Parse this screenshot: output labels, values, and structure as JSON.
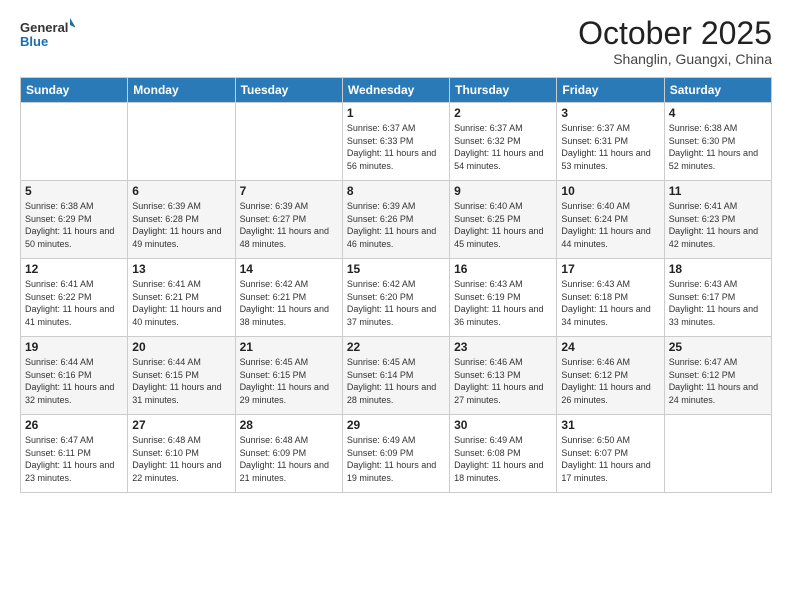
{
  "header": {
    "logo_general": "General",
    "logo_blue": "Blue",
    "month": "October 2025",
    "location": "Shanglin, Guangxi, China"
  },
  "days_of_week": [
    "Sunday",
    "Monday",
    "Tuesday",
    "Wednesday",
    "Thursday",
    "Friday",
    "Saturday"
  ],
  "weeks": [
    [
      {
        "day": "",
        "sunrise": "",
        "sunset": "",
        "daylight": ""
      },
      {
        "day": "",
        "sunrise": "",
        "sunset": "",
        "daylight": ""
      },
      {
        "day": "",
        "sunrise": "",
        "sunset": "",
        "daylight": ""
      },
      {
        "day": "1",
        "sunrise": "Sunrise: 6:37 AM",
        "sunset": "Sunset: 6:33 PM",
        "daylight": "Daylight: 11 hours and 56 minutes."
      },
      {
        "day": "2",
        "sunrise": "Sunrise: 6:37 AM",
        "sunset": "Sunset: 6:32 PM",
        "daylight": "Daylight: 11 hours and 54 minutes."
      },
      {
        "day": "3",
        "sunrise": "Sunrise: 6:37 AM",
        "sunset": "Sunset: 6:31 PM",
        "daylight": "Daylight: 11 hours and 53 minutes."
      },
      {
        "day": "4",
        "sunrise": "Sunrise: 6:38 AM",
        "sunset": "Sunset: 6:30 PM",
        "daylight": "Daylight: 11 hours and 52 minutes."
      }
    ],
    [
      {
        "day": "5",
        "sunrise": "Sunrise: 6:38 AM",
        "sunset": "Sunset: 6:29 PM",
        "daylight": "Daylight: 11 hours and 50 minutes."
      },
      {
        "day": "6",
        "sunrise": "Sunrise: 6:39 AM",
        "sunset": "Sunset: 6:28 PM",
        "daylight": "Daylight: 11 hours and 49 minutes."
      },
      {
        "day": "7",
        "sunrise": "Sunrise: 6:39 AM",
        "sunset": "Sunset: 6:27 PM",
        "daylight": "Daylight: 11 hours and 48 minutes."
      },
      {
        "day": "8",
        "sunrise": "Sunrise: 6:39 AM",
        "sunset": "Sunset: 6:26 PM",
        "daylight": "Daylight: 11 hours and 46 minutes."
      },
      {
        "day": "9",
        "sunrise": "Sunrise: 6:40 AM",
        "sunset": "Sunset: 6:25 PM",
        "daylight": "Daylight: 11 hours and 45 minutes."
      },
      {
        "day": "10",
        "sunrise": "Sunrise: 6:40 AM",
        "sunset": "Sunset: 6:24 PM",
        "daylight": "Daylight: 11 hours and 44 minutes."
      },
      {
        "day": "11",
        "sunrise": "Sunrise: 6:41 AM",
        "sunset": "Sunset: 6:23 PM",
        "daylight": "Daylight: 11 hours and 42 minutes."
      }
    ],
    [
      {
        "day": "12",
        "sunrise": "Sunrise: 6:41 AM",
        "sunset": "Sunset: 6:22 PM",
        "daylight": "Daylight: 11 hours and 41 minutes."
      },
      {
        "day": "13",
        "sunrise": "Sunrise: 6:41 AM",
        "sunset": "Sunset: 6:21 PM",
        "daylight": "Daylight: 11 hours and 40 minutes."
      },
      {
        "day": "14",
        "sunrise": "Sunrise: 6:42 AM",
        "sunset": "Sunset: 6:21 PM",
        "daylight": "Daylight: 11 hours and 38 minutes."
      },
      {
        "day": "15",
        "sunrise": "Sunrise: 6:42 AM",
        "sunset": "Sunset: 6:20 PM",
        "daylight": "Daylight: 11 hours and 37 minutes."
      },
      {
        "day": "16",
        "sunrise": "Sunrise: 6:43 AM",
        "sunset": "Sunset: 6:19 PM",
        "daylight": "Daylight: 11 hours and 36 minutes."
      },
      {
        "day": "17",
        "sunrise": "Sunrise: 6:43 AM",
        "sunset": "Sunset: 6:18 PM",
        "daylight": "Daylight: 11 hours and 34 minutes."
      },
      {
        "day": "18",
        "sunrise": "Sunrise: 6:43 AM",
        "sunset": "Sunset: 6:17 PM",
        "daylight": "Daylight: 11 hours and 33 minutes."
      }
    ],
    [
      {
        "day": "19",
        "sunrise": "Sunrise: 6:44 AM",
        "sunset": "Sunset: 6:16 PM",
        "daylight": "Daylight: 11 hours and 32 minutes."
      },
      {
        "day": "20",
        "sunrise": "Sunrise: 6:44 AM",
        "sunset": "Sunset: 6:15 PM",
        "daylight": "Daylight: 11 hours and 31 minutes."
      },
      {
        "day": "21",
        "sunrise": "Sunrise: 6:45 AM",
        "sunset": "Sunset: 6:15 PM",
        "daylight": "Daylight: 11 hours and 29 minutes."
      },
      {
        "day": "22",
        "sunrise": "Sunrise: 6:45 AM",
        "sunset": "Sunset: 6:14 PM",
        "daylight": "Daylight: 11 hours and 28 minutes."
      },
      {
        "day": "23",
        "sunrise": "Sunrise: 6:46 AM",
        "sunset": "Sunset: 6:13 PM",
        "daylight": "Daylight: 11 hours and 27 minutes."
      },
      {
        "day": "24",
        "sunrise": "Sunrise: 6:46 AM",
        "sunset": "Sunset: 6:12 PM",
        "daylight": "Daylight: 11 hours and 26 minutes."
      },
      {
        "day": "25",
        "sunrise": "Sunrise: 6:47 AM",
        "sunset": "Sunset: 6:12 PM",
        "daylight": "Daylight: 11 hours and 24 minutes."
      }
    ],
    [
      {
        "day": "26",
        "sunrise": "Sunrise: 6:47 AM",
        "sunset": "Sunset: 6:11 PM",
        "daylight": "Daylight: 11 hours and 23 minutes."
      },
      {
        "day": "27",
        "sunrise": "Sunrise: 6:48 AM",
        "sunset": "Sunset: 6:10 PM",
        "daylight": "Daylight: 11 hours and 22 minutes."
      },
      {
        "day": "28",
        "sunrise": "Sunrise: 6:48 AM",
        "sunset": "Sunset: 6:09 PM",
        "daylight": "Daylight: 11 hours and 21 minutes."
      },
      {
        "day": "29",
        "sunrise": "Sunrise: 6:49 AM",
        "sunset": "Sunset: 6:09 PM",
        "daylight": "Daylight: 11 hours and 19 minutes."
      },
      {
        "day": "30",
        "sunrise": "Sunrise: 6:49 AM",
        "sunset": "Sunset: 6:08 PM",
        "daylight": "Daylight: 11 hours and 18 minutes."
      },
      {
        "day": "31",
        "sunrise": "Sunrise: 6:50 AM",
        "sunset": "Sunset: 6:07 PM",
        "daylight": "Daylight: 11 hours and 17 minutes."
      },
      {
        "day": "",
        "sunrise": "",
        "sunset": "",
        "daylight": ""
      }
    ]
  ]
}
